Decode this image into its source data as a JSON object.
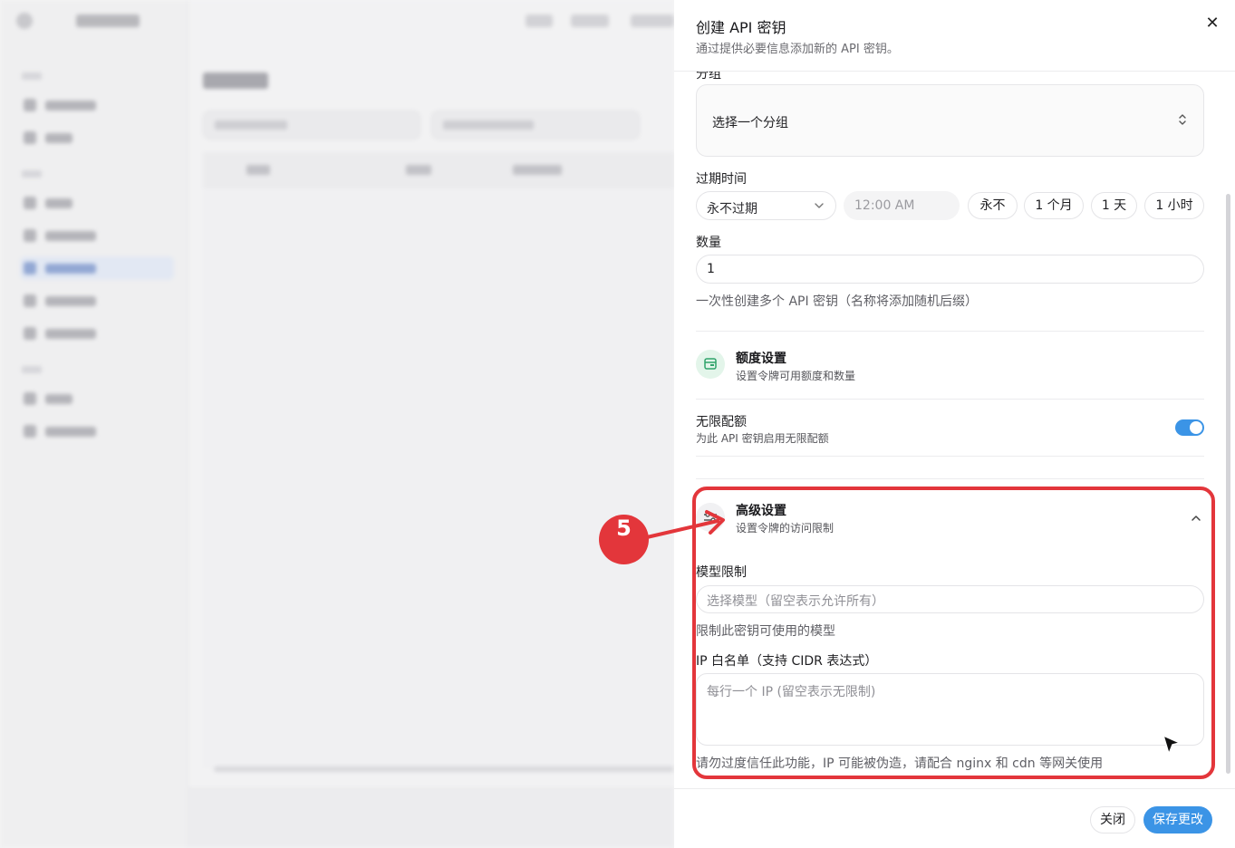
{
  "drawer": {
    "title": "创建 API 密钥",
    "description": "通过提供必要信息添加新的 API 密钥。",
    "close_icon": "close-icon",
    "group": {
      "label": "分组",
      "placeholder": "选择一个分组"
    },
    "expiry": {
      "label": "过期时间",
      "selected": "永不过期",
      "time_placeholder": "12:00 AM",
      "quick_options": [
        "永不",
        "1 个月",
        "1 天",
        "1 小时"
      ]
    },
    "quantity": {
      "label": "数量",
      "value": "1",
      "help": "一次性创建多个 API 密钥（名称将添加随机后缀）"
    },
    "quota_section": {
      "title": "额度设置",
      "subtitle": "设置令牌可用额度和数量",
      "icon": "wallet-icon"
    },
    "unlimited_quota": {
      "title": "无限配额",
      "subtitle": "为此 API 密钥启用无限配额",
      "enabled": true
    },
    "advanced_section": {
      "title": "高级设置",
      "subtitle": "设置令牌的访问限制",
      "icon": "sliders-icon",
      "expanded": true
    },
    "model_limit": {
      "label": "模型限制",
      "placeholder": "选择模型（留空表示允许所有）",
      "help": "限制此密钥可使用的模型"
    },
    "ip_whitelist": {
      "label": "IP 白名单（支持 CIDR 表达式）",
      "placeholder": "每行一个 IP (留空表示无限制)",
      "help": "请勿过度信任此功能，IP 可能被伪造，请配合 nginx 和 cdn 等网关使用"
    },
    "footer": {
      "close_label": "关闭",
      "save_label": "保存更改"
    }
  },
  "annotation": {
    "step_number": "5",
    "color": "#e3363b"
  },
  "colors": {
    "accent": "#3b94e6",
    "quota_icon_bg": "#e3f5ea",
    "quota_icon_fg": "#2fa36b"
  }
}
